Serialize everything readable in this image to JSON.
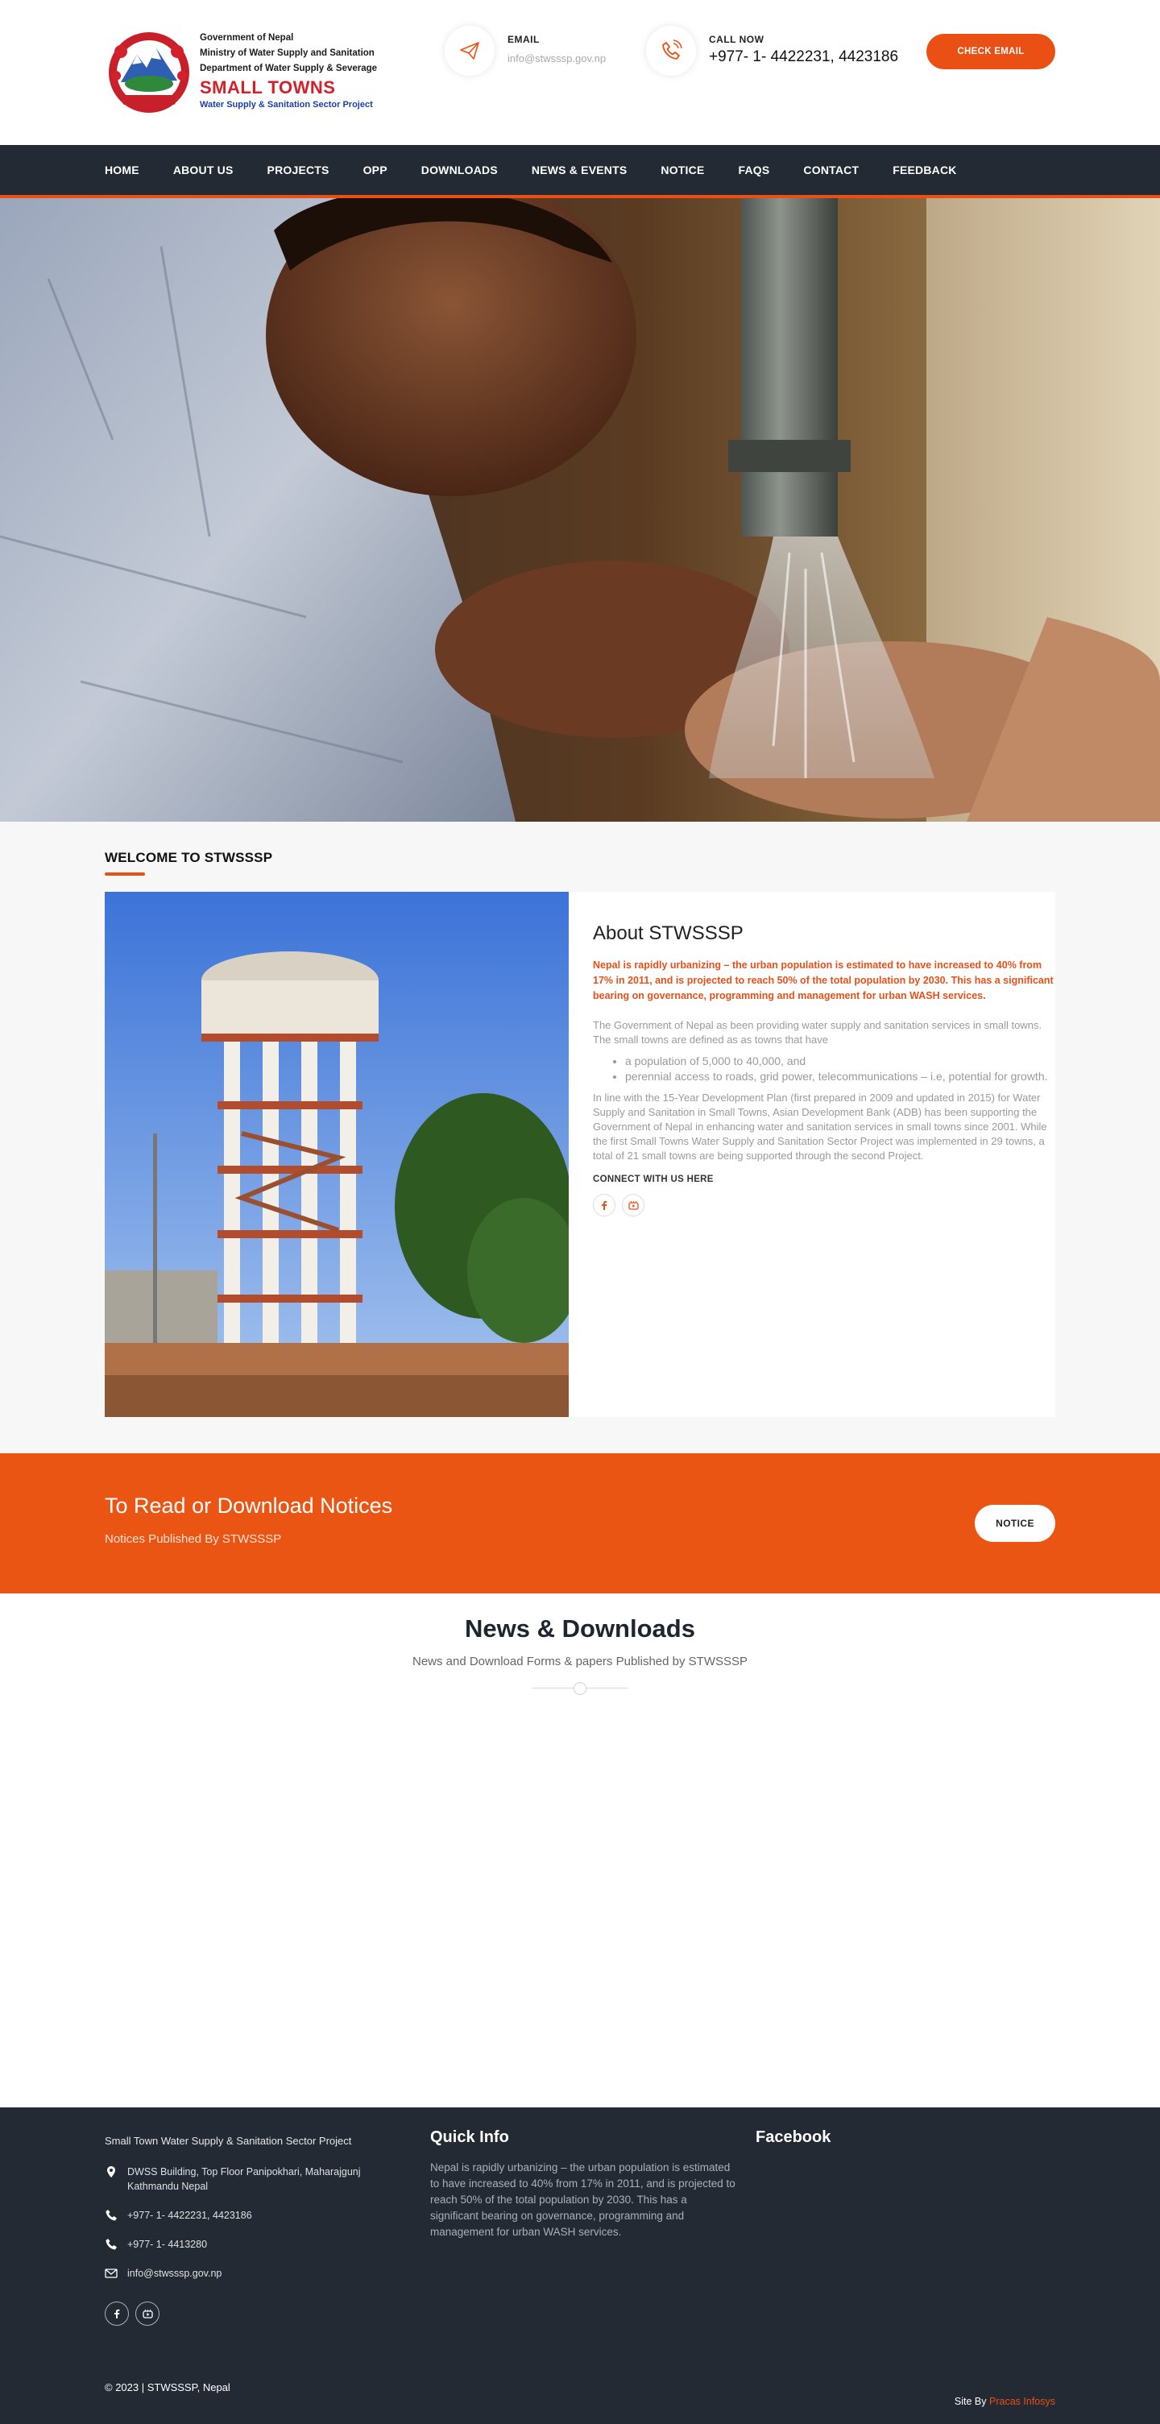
{
  "header": {
    "logo": {
      "line1": "Government of Nepal",
      "line2": "Ministry of Water Supply and Sanitation",
      "line3": "Department of Water Supply & Severage",
      "brand": "SMALL TOWNS",
      "tagline": "Water Supply & Sanitation Sector Project"
    },
    "email": {
      "label": "EMAIL",
      "value": "info@stwsssp.gov.np",
      "icon": "paper-plane-icon"
    },
    "call": {
      "label": "CALL NOW",
      "value": "+977- 1- 4422231, 4423186",
      "icon": "phone-icon"
    },
    "cta": "CHECK EMAIL",
    "accent": "#ea5013"
  },
  "nav": {
    "items": [
      "HOME",
      "ABOUT US",
      "PROJECTS",
      "OPP",
      "DOWNLOADS",
      "NEWS & EVENTS",
      "NOTICE",
      "FAQS",
      "CONTACT",
      "FEEDBACK"
    ]
  },
  "welcome": {
    "title": "WELCOME TO STWSSSP",
    "about_title": "About STWSSSP",
    "lead": "Nepal is rapidly urbanizing – the urban population is estimated to have increased to 40% from 17% in 2011, and is projected to reach 50% of the total population by 2030. This has a significant bearing on governance, programming and management for urban WASH services.",
    "para1": "The Government of Nepal as been providing water supply and sanitation services in small towns. The small towns are defined as as towns that have",
    "bullets": [
      "a population of 5,000 to 40,000, and",
      "perennial access to roads, grid power, telecommunications – i.e, potential for growth."
    ],
    "para2": "In line with the 15-Year Development Plan (first prepared in 2009 and updated in 2015) for Water Supply and Sanitation in Small Towns, Asian Development Bank (ADB) has been supporting the Government of Nepal in enhancing water and sanitation services in small towns since 2001. While the first Small Towns Water Supply and Sanitation Sector Project was implemented in 29 towns, a total of 21 small towns are being supported through the second Project.",
    "connect": "CONNECT WITH US HERE"
  },
  "notice_band": {
    "title": "To Read or Download Notices",
    "subtitle": "Notices Published By STWSSSP",
    "button": "NOTICE"
  },
  "news": {
    "title": "News & Downloads",
    "subtitle": "News and Download Forms & papers Published by STWSSSP"
  },
  "footer": {
    "org": "Small Town Water Supply & Sanitation Sector Project",
    "address": "DWSS Building, Top Floor Panipokhari, Maharajgunj Kathmandu Nepal",
    "phone1": "+977- 1- 4422231, 4423186",
    "phone2": "+977- 1- 4413280",
    "email": "info@stwsssp.gov.np",
    "quick_info_title": "Quick Info",
    "quick_info": "Nepal is rapidly urbanizing – the urban population is estimated to have increased to 40% from 17% in 2011, and is projected to reach 50% of the total population by 2030. This has a significant bearing on governance, programming and management for urban WASH services.",
    "facebook_title": "Facebook",
    "copyright": "© 2023 | STWSSSP, Nepal",
    "siteby_label": "Site By",
    "siteby_link": "Pracas Infosys"
  }
}
